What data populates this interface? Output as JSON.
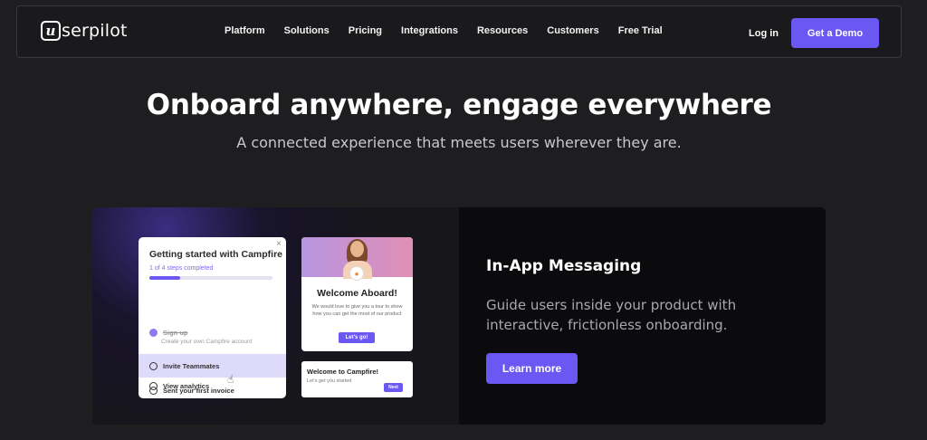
{
  "nav": {
    "logo_mark": "u",
    "logo_text": "serpilot",
    "items": [
      "Platform",
      "Solutions",
      "Pricing",
      "Integrations",
      "Resources",
      "Customers",
      "Free Trial"
    ],
    "login": "Log in",
    "demo": "Get a Demo"
  },
  "hero": {
    "title": "Onboard anywhere, engage everywhere",
    "subtitle": "A connected experience that meets users wherever they are."
  },
  "checklist": {
    "close": "×",
    "title": "Getting started with Campfire",
    "progress_text": "1 of 4 steps completed",
    "progress": 0.25,
    "items": [
      {
        "label": "Sign up",
        "sub": "Create your own Campfire account",
        "done": true
      },
      {
        "label": "Invite Teammates",
        "done": false,
        "active": true
      },
      {
        "label": "Sent your first invoice",
        "done": false
      },
      {
        "label": "View analytics",
        "done": false
      }
    ]
  },
  "welcome": {
    "title": "Welcome Aboard!",
    "body": "We would love to give you a tour to show how you can get the most of our product",
    "button": "Let's go!"
  },
  "tooltip": {
    "title": "Welcome to Campfire!",
    "body": "Let's get you started",
    "button": "Next"
  },
  "feature": {
    "title": "In-App Messaging",
    "description": "Guide users inside your product with interactive, frictionless onboarding.",
    "button": "Learn more"
  },
  "colors": {
    "accent": "#6b57f1",
    "background": "#1e1d20"
  }
}
